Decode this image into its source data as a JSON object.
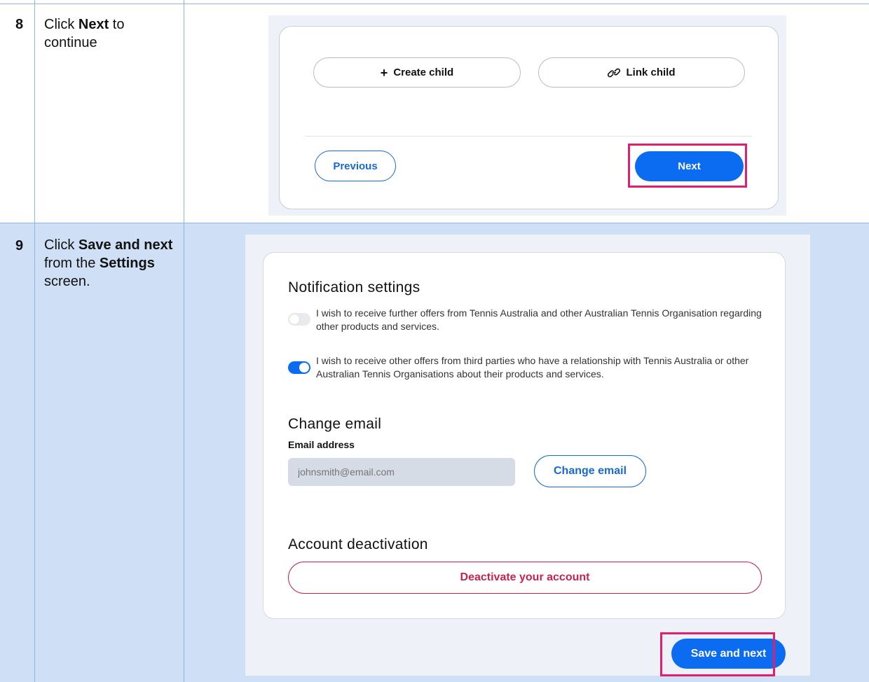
{
  "steps": [
    {
      "number": "8",
      "instruction": {
        "pre": "Click ",
        "bold1": "Next",
        "post1": " to continue"
      },
      "screenshot": {
        "create_child_label": "Create child",
        "link_child_label": "Link child",
        "previous_label": "Previous",
        "next_label": "Next"
      }
    },
    {
      "number": "9",
      "instruction": {
        "pre": "Click ",
        "bold1": "Save and next",
        "mid": " from the ",
        "bold2": "Settings",
        "post": " screen."
      },
      "screenshot": {
        "notification_title": "Notification settings",
        "preferences": [
          {
            "text": "I wish to receive further offers from Tennis Australia and other Australian Tennis Organisation regarding other products and services.",
            "enabled": false
          },
          {
            "text": "I wish to receive other offers from third parties who have a relationship with Tennis Australia or other Australian Tennis Organisations about their products and services.",
            "enabled": true
          }
        ],
        "change_email_title": "Change email",
        "email_label": "Email address",
        "email_placeholder": "johnsmith@email.com",
        "change_email_button": "Change email",
        "deactivation_title": "Account deactivation",
        "deactivate_button": "Deactivate your account",
        "save_button": "Save and next"
      }
    }
  ],
  "colors": {
    "primary": "#0b6cf2",
    "highlight": "#e0206e",
    "danger": "#c8234f",
    "row_alt": "#cfe0f6"
  },
  "icons": {
    "create": "plus-icon",
    "link": "link-icon"
  }
}
